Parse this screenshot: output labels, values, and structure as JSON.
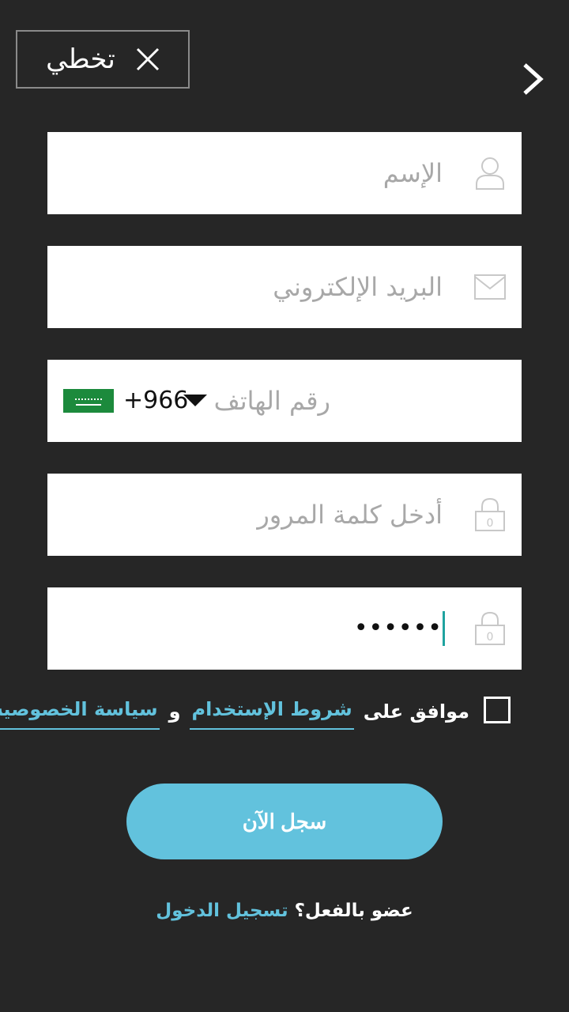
{
  "header": {
    "skip_label": "تخطي",
    "close_icon": "close-icon",
    "next_icon": "chevron-right-icon"
  },
  "form": {
    "name": {
      "placeholder": "الإسم",
      "icon": "user-icon"
    },
    "email": {
      "placeholder": "البريد الإلكتروني",
      "icon": "envelope-icon"
    },
    "phone": {
      "placeholder": "رقم الهاتف",
      "country_code": "+966",
      "flag_icon": "saudi-flag-icon",
      "dropdown_icon": "caret-down-icon"
    },
    "password": {
      "placeholder": "أدخل كلمة المرور",
      "icon": "lock-icon",
      "lock_badge": "0"
    },
    "confirm_password": {
      "value": "••••••",
      "icon": "lock-icon",
      "lock_badge": "0"
    }
  },
  "terms": {
    "agree_text": "موافق على",
    "terms_link": "شروط الإستخدام",
    "and_text": "و",
    "privacy_link": "سياسة الخصوصية",
    "checked": false
  },
  "submit_label": "سجل الآن",
  "login": {
    "question": "عضو بالفعل؟",
    "link": "تسجيل الدخول"
  },
  "colors": {
    "background": "#262626",
    "accent": "#62c2dd",
    "field_bg": "#ffffff",
    "placeholder": "#a8a8a8",
    "cursor": "#1fa3a0"
  }
}
